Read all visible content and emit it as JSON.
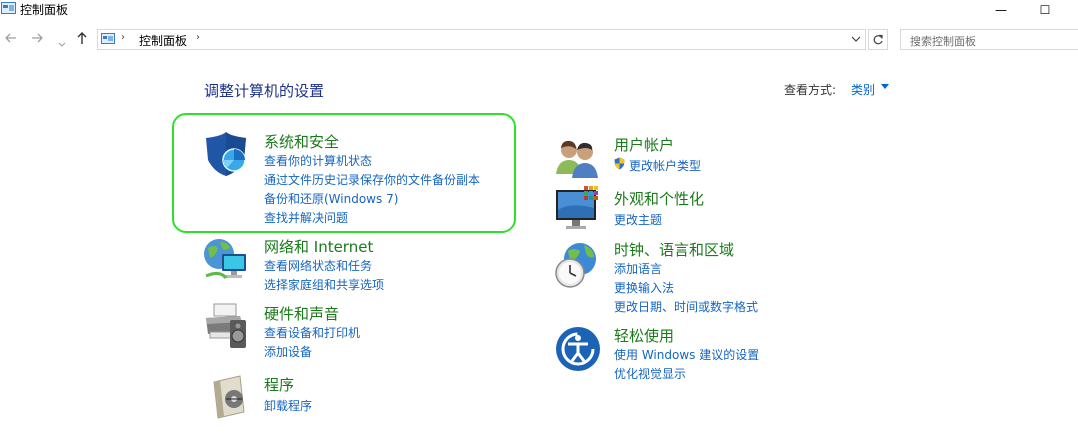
{
  "window": {
    "title": "控制面板",
    "minimize_glyph": "—",
    "maximize_glyph": "☐"
  },
  "nav": {
    "back_icon": "arrow-left-icon",
    "forward_icon": "arrow-right-icon",
    "up_icon": "arrow-up-icon",
    "breadcrumb": "控制面板",
    "search_placeholder": "搜索控制面板"
  },
  "header": {
    "title": "调整计算机的设置",
    "view_by_label": "查看方式:",
    "view_by_value": "类别"
  },
  "colors": {
    "category_title": "#1a7a1a",
    "link": "#1565c0",
    "header_title": "#1e3287",
    "highlight_border": "#2fe02a"
  },
  "categories": {
    "system_security": {
      "title": "系统和安全",
      "links": [
        "查看你的计算机状态",
        "通过文件历史记录保存你的文件备份副本",
        "备份和还原(Windows 7)",
        "查找并解决问题"
      ]
    },
    "network": {
      "title": "网络和 Internet",
      "links": [
        "查看网络状态和任务",
        "选择家庭组和共享选项"
      ]
    },
    "hardware": {
      "title": "硬件和声音",
      "links": [
        "查看设备和打印机",
        "添加设备"
      ]
    },
    "programs": {
      "title": "程序",
      "links": [
        "卸载程序"
      ]
    },
    "user_accounts": {
      "title": "用户帐户",
      "links": [
        "更改帐户类型"
      ]
    },
    "appearance": {
      "title": "外观和个性化",
      "links": [
        "更改主题"
      ]
    },
    "clock_region": {
      "title": "时钟、语言和区域",
      "links": [
        "添加语言",
        "更换输入法",
        "更改日期、时间或数字格式"
      ]
    },
    "ease_access": {
      "title": "轻松使用",
      "links": [
        "使用 Windows 建议的设置",
        "优化视觉显示"
      ]
    }
  }
}
